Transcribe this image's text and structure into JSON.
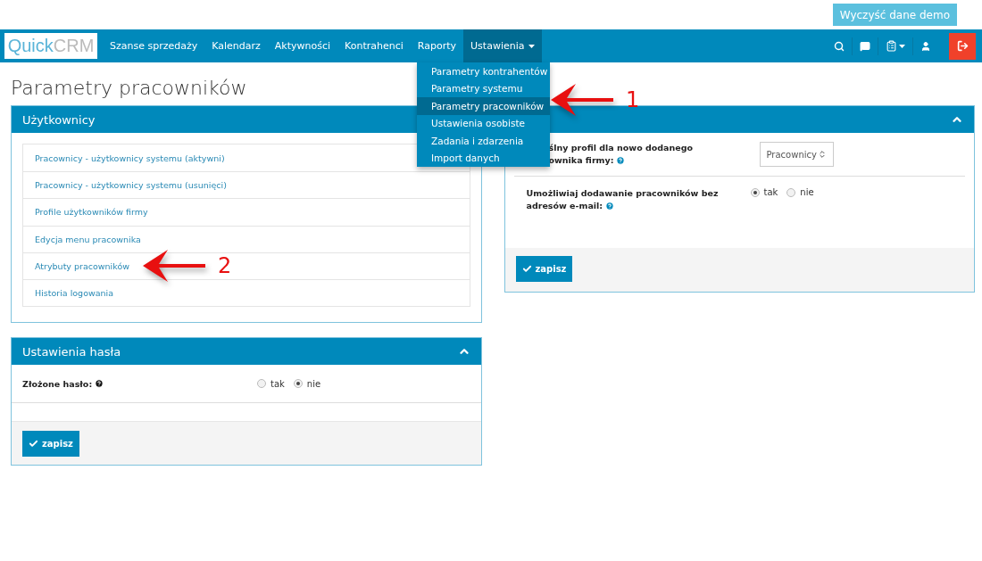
{
  "topbar": {
    "demo_button": "Wyczyść dane demo"
  },
  "navbar": {
    "logo": {
      "part_1": "Quick",
      "part_2": "CRM"
    },
    "items": [
      {
        "label": "Szanse sprzedaży",
        "selected": false
      },
      {
        "label": "Kalendarz",
        "selected": false
      },
      {
        "label": "Aktywności",
        "selected": false
      },
      {
        "label": "Kontrahenci",
        "selected": false
      },
      {
        "label": "Raporty",
        "selected": false
      },
      {
        "label": "Ustawienia",
        "selected": true,
        "dropdown": true
      }
    ],
    "dropdown_menu": [
      {
        "label": "Parametry kontrahentów",
        "selected": false
      },
      {
        "label": "Parametry systemu",
        "selected": false
      },
      {
        "label": "Parametry pracowników",
        "selected": true
      },
      {
        "label": "Ustawienia osobiste",
        "selected": false
      },
      {
        "label": "Zadania i zdarzenia",
        "selected": false
      },
      {
        "label": "Import danych",
        "selected": false
      }
    ]
  },
  "page_title": "Parametry pracowników",
  "users_panel": {
    "title": "Użytkownicy",
    "links": [
      "Pracownicy - użytkownicy systemu (aktywni)",
      "Pracownicy - użytkownicy systemu (usunięci)",
      "Profile użytkowników firmy",
      "Edycja menu pracownika",
      "Atrybuty pracowników",
      "Historia logowania"
    ]
  },
  "password_panel": {
    "title": "Ustawienia hasła",
    "setting": {
      "label": "Złożone hasło:",
      "options": [
        {
          "label": "tak",
          "selected": false
        },
        {
          "label": "nie",
          "selected": true
        }
      ]
    },
    "save_button": "zapisz"
  },
  "employee_panel": {
    "settings": [
      {
        "kind": "select",
        "label_lines": [
          "ślny profil dla nowo dodanego",
          "ownika firmy:"
        ],
        "value": "Pracownicy"
      },
      {
        "kind": "radio",
        "label_lines": [
          "Umożliwiaj dodawanie pracowników bez",
          "adresów e-mail:"
        ],
        "options": [
          {
            "label": "tak",
            "selected": true
          },
          {
            "label": "nie",
            "selected": false
          }
        ]
      }
    ],
    "save_button": "zapisz"
  },
  "annotations": [
    {
      "number": "1"
    },
    {
      "number": "2"
    }
  ]
}
